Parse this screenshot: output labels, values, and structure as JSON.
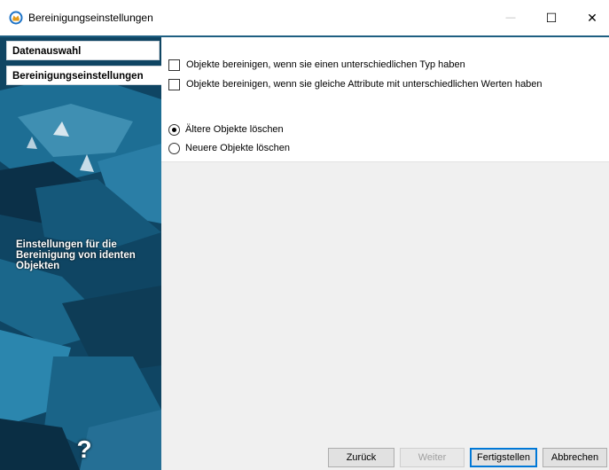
{
  "window": {
    "title": "Bereinigungseinstellungen",
    "icon": "app-icon",
    "controls": {
      "minimize": "—",
      "maximize": "☐",
      "close": "✕"
    }
  },
  "sidebar": {
    "items": [
      {
        "label": "Datenauswahl"
      },
      {
        "label": "Bereinigungseinstellungen"
      }
    ],
    "caption": "Einstellungen für die Bereinigung von identen Objekten",
    "help": "?"
  },
  "options": {
    "checkboxes": [
      {
        "label": "Objekte bereinigen, wenn sie einen unterschiedlichen Typ haben",
        "checked": false
      },
      {
        "label": "Objekte bereinigen, wenn sie gleiche Attribute mit unterschiedlichen Werten haben",
        "checked": false
      }
    ],
    "radios": [
      {
        "label": "Ältere Objekte löschen",
        "checked": true
      },
      {
        "label": "Neuere Objekte löschen",
        "checked": false
      }
    ]
  },
  "buttons": {
    "back": "Zurück",
    "next": "Weiter",
    "finish": "Fertigstellen",
    "cancel": "Abbrechen"
  },
  "colors": {
    "accent": "#1e5f82",
    "sidebar_dark": "#0d3952",
    "default_button_border": "#0078d7"
  }
}
